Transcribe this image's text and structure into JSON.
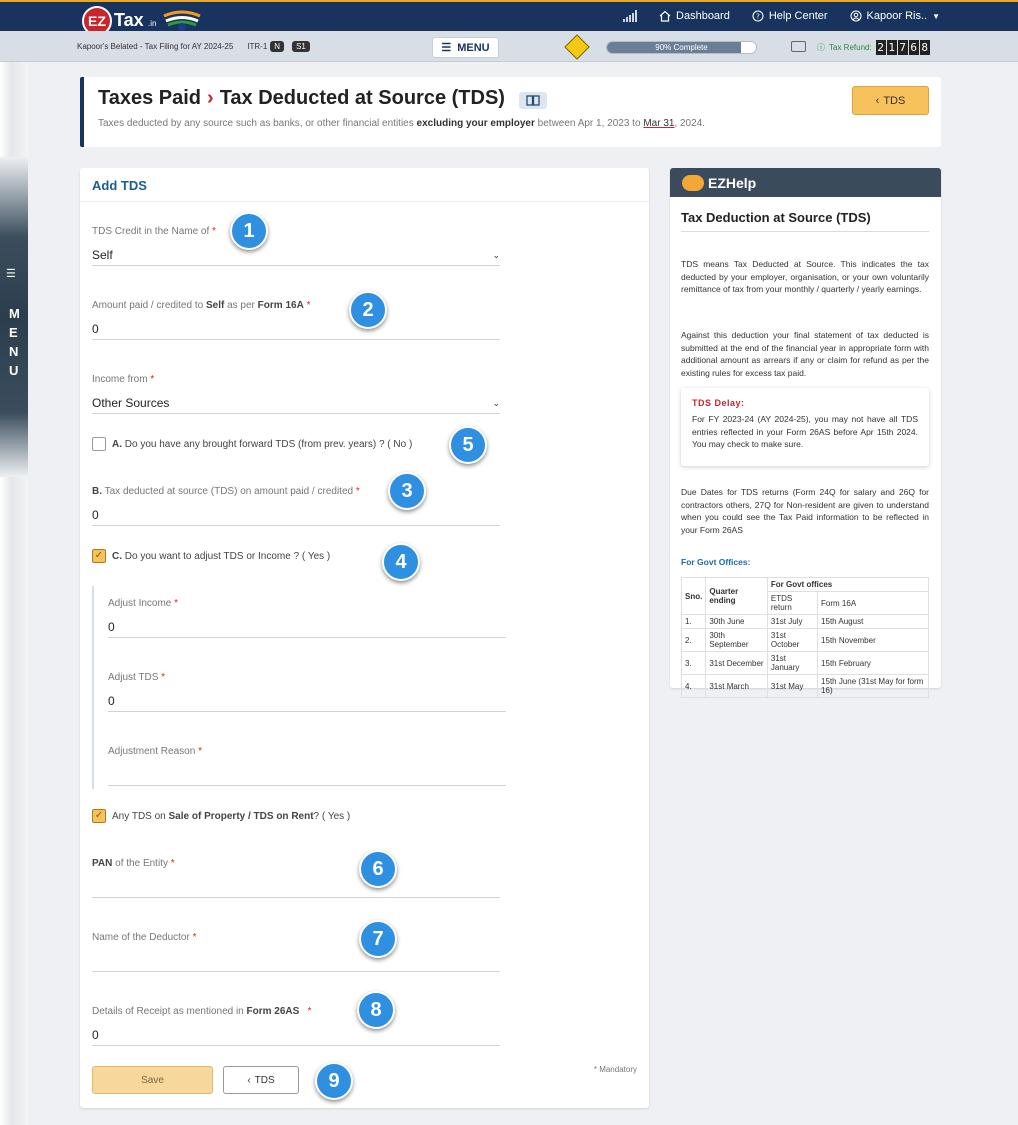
{
  "app": {
    "logo_ez": "EZ",
    "logo_tax": "Tax",
    "logo_in": ".in"
  },
  "nav": {
    "dashboard": "Dashboard",
    "help_center": "Help Center",
    "user": "Kapoor Ris.."
  },
  "subbar": {
    "filing": "Kapoor's Belated - Tax Filing for AY 2024-25",
    "itr": "ITR-1",
    "badge_n": "N",
    "badge_s1": "S1",
    "menu_label": "MENU",
    "progress_label": "90% Complete",
    "progress_value": 0.9,
    "refund_label": "Tax Refund:",
    "refund_digits": [
      "2",
      "1",
      "7",
      "6",
      "8"
    ]
  },
  "side_menu": {
    "letters": [
      "M",
      "E",
      "N",
      "U"
    ]
  },
  "header": {
    "title_parent": "Taxes Paid",
    "title_current": "Tax Deducted at Source (TDS)",
    "subtitle_pre": "Taxes deducted by any source such as banks, or other financial entities ",
    "subtitle_bold": "excluding your employer",
    "subtitle_mid": " between Apr 1, 2023 to ",
    "subtitle_date": "Mar 31",
    "subtitle_end": ", 2024.",
    "tds_button": "TDS"
  },
  "form": {
    "title": "Add TDS",
    "credit_label": "TDS Credit in the Name of",
    "credit_value": "Self",
    "amount_label_pre": "Amount paid / credited to ",
    "amount_label_bold1": "Self",
    "amount_label_mid": " as per ",
    "amount_label_bold2": "Form 16A",
    "amount_value": "0",
    "income_label": "Income from",
    "income_value": "Other Sources",
    "brought_forward_label_bold": "A.",
    "brought_forward_label": " Do you have any brought forward TDS (from prev. years) ? ( No )",
    "tds_b_label_bold": "B.",
    "tds_b_label": " Tax deducted at source (TDS) on amount paid / credited",
    "tds_b_value": "0",
    "adjust_label_bold": "C.",
    "adjust_label": " Do you want to adjust TDS or Income ? ( Yes )",
    "adjust_income_label": "Adjust Income",
    "adjust_income_value": "0",
    "adjust_tds_label": "Adjust TDS",
    "adjust_tds_value": "0",
    "adjust_reason_label": "Adjustment Reason",
    "adjust_reason_value": "",
    "property_label_pre": "Any TDS on ",
    "property_label_bold": "Sale of Property / TDS on Rent",
    "property_label_end": "? ( Yes )",
    "pan_label_bold": "PAN",
    "pan_label": " of the Entity",
    "pan_value": "",
    "deductor_label": "Name of the Deductor",
    "deductor_value": "",
    "receipt_label_pre": "Details of Receipt as mentioned in ",
    "receipt_label_bold": "Form 26AS",
    "receipt_value": "0",
    "required_mark": "*",
    "mandatory_note": "* Mandatory",
    "save_button": "Save",
    "back_button": "TDS"
  },
  "steps": [
    "1",
    "2",
    "5",
    "3",
    "4",
    "6",
    "7",
    "8",
    "9"
  ],
  "help": {
    "head": "EZHelp",
    "title": "Tax Deduction at Source (TDS)",
    "para1": "TDS means Tax Deducted at Source. This indicates the tax deducted by your employer, organisation, or your own voluntarily remittance of tax from your monthly / quarterly / yearly earnings.",
    "para2": "Against this deduction your final statement of tax deducted is submitted at the end of the financial year in appropriate form with additional amount as arrears if any or claim for refund as per the existing rules for excess tax paid.",
    "delay_title": "TDS Delay:",
    "delay_text": "For FY 2023-24 (AY 2024-25), you may not have all TDS entries reflected in your Form 26AS before Apr 15th 2024. You may check to make sure.",
    "para3": "Due Dates for TDS returns (Form 24Q for salary and 26Q for contractors others, 27Q for Non-resident are given to understand when you could see the Tax Paid information to be reflected in your Form 26AS",
    "govt_title": "For Govt Offices:",
    "table": {
      "h_sno": "Sno.",
      "h_quarter": "Quarter ending",
      "h_group": "For Govt offices",
      "h_etds": "ETDS return",
      "h_form16a": "Form 16A",
      "rows": [
        {
          "sno": "1.",
          "quarter": "30th June",
          "etds": "31st July",
          "form16a": "15th August"
        },
        {
          "sno": "2.",
          "quarter": "30th September",
          "etds": "31st October",
          "form16a": "15th November"
        },
        {
          "sno": "3.",
          "quarter": "31st December",
          "etds": "31st January",
          "form16a": "15th February"
        },
        {
          "sno": "4.",
          "quarter": "31st March",
          "etds": "31st May",
          "form16a": "15th June (31st May for form 16)"
        }
      ]
    }
  },
  "colors": {
    "nav_bg": "#18335e",
    "brand_red": "#c9262c",
    "accent_orange": "#f7c25b",
    "step_blue": "#2f8fe0"
  }
}
